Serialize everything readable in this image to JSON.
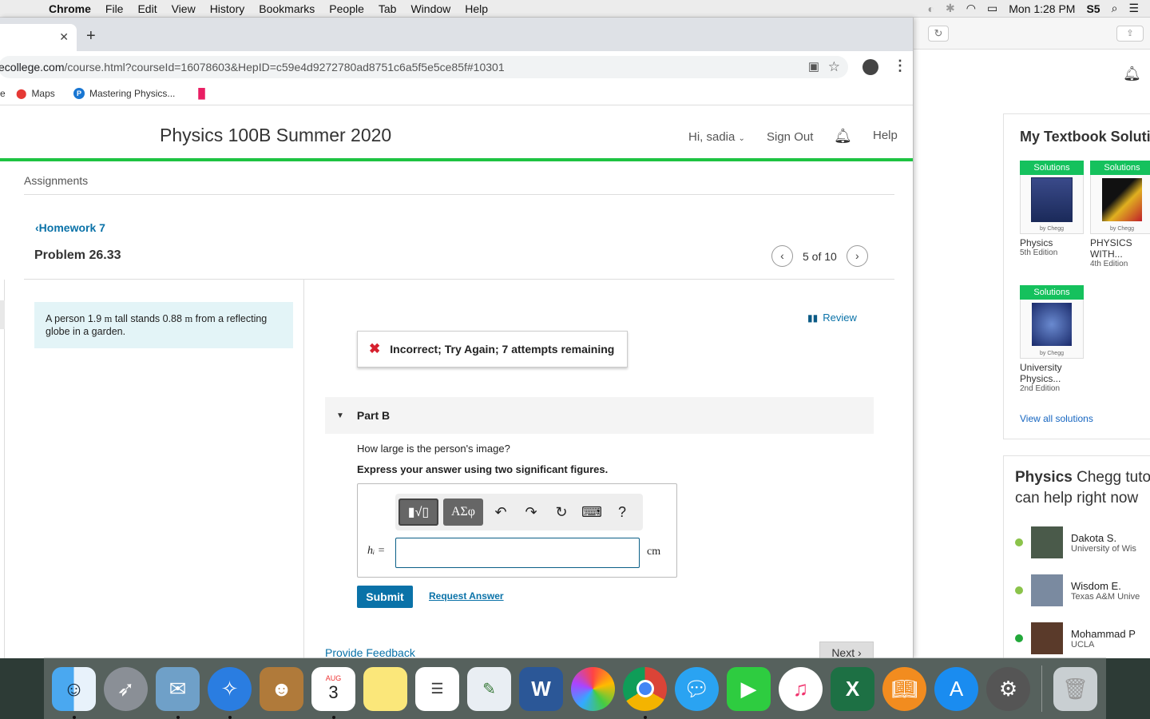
{
  "menubar": {
    "app": "Chrome",
    "items": [
      "File",
      "Edit",
      "View",
      "History",
      "Bookmarks",
      "People",
      "Tab",
      "Window",
      "Help"
    ],
    "clock": "Mon 1:28 PM",
    "user": "S5"
  },
  "browser": {
    "url_prefix": "ecollege.com",
    "url_rest": "/course.html?courseId=16078603&HepID=c59e4d9272780ad8751c6a5f5e5ce85f#10301",
    "bookmarks": [
      "Maps",
      "Mastering Physics..."
    ]
  },
  "course": {
    "title": "Physics 100B Summer 2020",
    "greeting": "Hi, sadia",
    "sign_out": "Sign Out",
    "help": "Help"
  },
  "breadcrumb": "Assignments",
  "homework_link": "Homework 7",
  "problem_title": "Problem 26.33",
  "pager": {
    "text": "5 of 10"
  },
  "intro": {
    "pre": "A person 1.9 ",
    "u1": "m",
    "mid": " tall stands 0.88 ",
    "u2": "m",
    "post": " from a reflecting globe in a garden."
  },
  "review_label": "Review",
  "feedback": "Incorrect; Try Again; 7 attempts remaining",
  "part": {
    "label": "Part B",
    "question": "How large is the person's image?",
    "instruction": "Express your answer using two significant figures.",
    "var_label": "hᵢ =",
    "unit": "cm",
    "answer_value": "",
    "toolbar": {
      "template_btn": "▮√▯",
      "symbols_btn": "ΑΣφ",
      "help": "?"
    }
  },
  "actions": {
    "submit": "Submit",
    "request_answer": "Request Answer",
    "provide_feedback": "Provide Feedback",
    "next": "Next"
  },
  "chegg": {
    "textbook_heading": "My Textbook Solutio",
    "badge": "Solutions",
    "by": "by Chegg",
    "books": [
      {
        "title": "Physics",
        "edition": "5th Edition"
      },
      {
        "title": "PHYSICS WITH...",
        "edition": "4th Edition"
      },
      {
        "title": "University Physics...",
        "edition": "2nd Edition"
      }
    ],
    "view_all": "View all solutions",
    "tutor_heading_bold": "Physics",
    "tutor_heading_rest": " Chegg tuto",
    "tutor_heading_line2": "can help right now",
    "tutors": [
      {
        "name": "Dakota S.",
        "school": "University of Wis"
      },
      {
        "name": "Wisdom E.",
        "school": "Texas A&M Unive"
      },
      {
        "name": "Mohammad P",
        "school": "UCLA"
      }
    ]
  },
  "dock": {
    "calendar_month": "AUG",
    "calendar_day": "3",
    "colors": {
      "accent_green": "#1ec342",
      "link_blue": "#0a72a8",
      "error_red": "#d6202e"
    }
  }
}
